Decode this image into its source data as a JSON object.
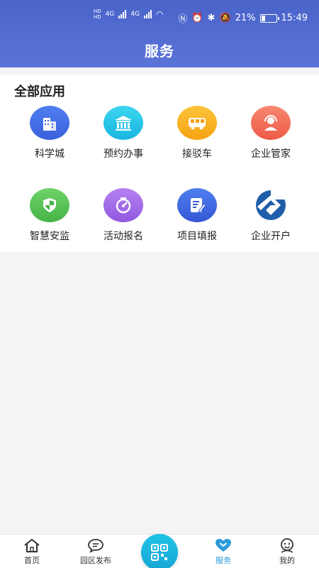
{
  "statusbar": {
    "battery": "21%",
    "time": "15:49",
    "network_1": "4G",
    "network_2": "4G"
  },
  "header": {
    "title": "服务"
  },
  "section": {
    "title": "全部应用"
  },
  "apps": [
    {
      "label": "科学城",
      "icon": "building-icon",
      "color": "#3f6ee8"
    },
    {
      "label": "预约办事",
      "icon": "bank-icon",
      "color": "#1fc6e8"
    },
    {
      "label": "接驳车",
      "icon": "bus-icon",
      "color": "#f8b21c"
    },
    {
      "label": "企业管家",
      "icon": "headset-agent-icon",
      "color": "#f4705a"
    },
    {
      "label": "智慧安监",
      "icon": "shield-icon",
      "color": "#5bc25a"
    },
    {
      "label": "活动报名",
      "icon": "speedometer-icon",
      "color": "#a66ae6"
    },
    {
      "label": "项目填报",
      "icon": "edit-form-icon",
      "color": "#3f6ee8"
    },
    {
      "label": "企业开户",
      "icon": "ccb-bank-logo-icon",
      "color": "#1f5ea8"
    }
  ],
  "nav": {
    "home": "首页",
    "park": "园区发布",
    "scan_icon": "qr-scan-icon",
    "service": "服务",
    "mine": "我的",
    "active_color": "#2a9bd8"
  }
}
